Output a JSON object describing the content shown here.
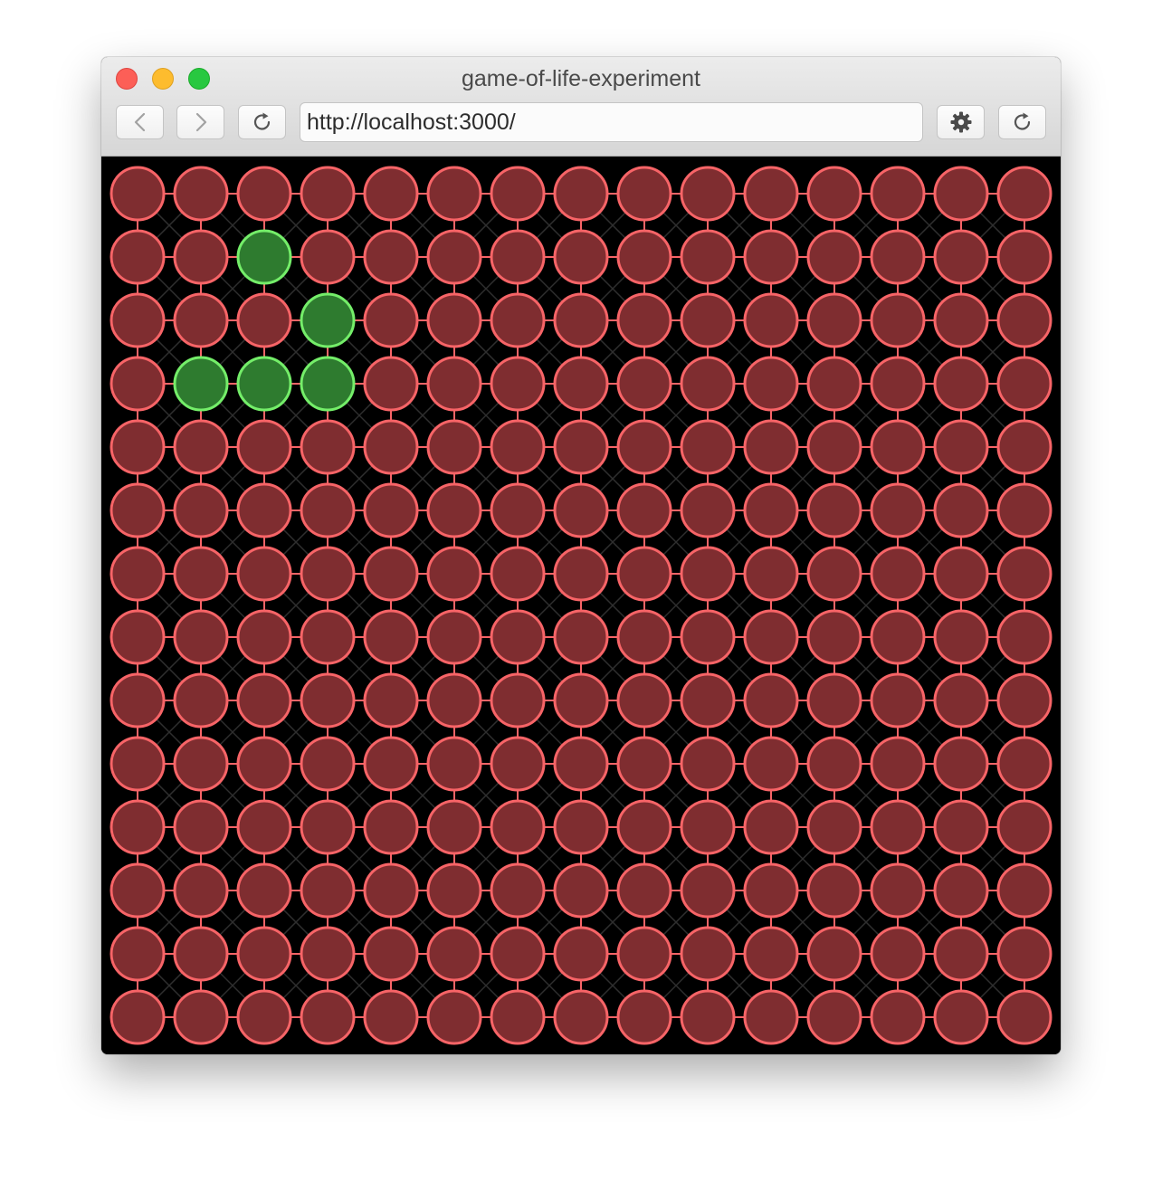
{
  "window": {
    "title": "game-of-life-experiment"
  },
  "toolbar": {
    "back_icon": "chevron-left-icon",
    "forward_icon": "chevron-right-icon",
    "reload_icon": "reload-icon",
    "settings_icon": "gear-icon",
    "url": "http://localhost:3000/"
  },
  "board": {
    "columns": 15,
    "rows": 14,
    "live_cells": [
      [
        1,
        2
      ],
      [
        2,
        3
      ],
      [
        3,
        1
      ],
      [
        3,
        2
      ],
      [
        3,
        3
      ]
    ],
    "colors": {
      "background": "#000000",
      "dead_fill": "#7f2d30",
      "dead_stroke": "#f76467",
      "live_fill": "#2e7b2f",
      "live_stroke": "#74ee69",
      "grid_diagonal": "#2f2f2f"
    }
  }
}
